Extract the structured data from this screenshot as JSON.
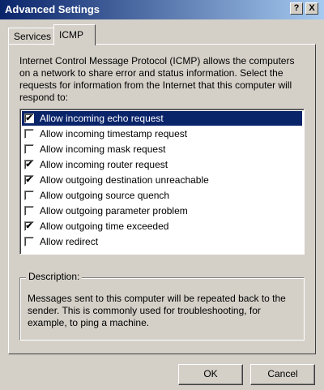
{
  "window": {
    "title": "Advanced Settings",
    "help_button": "?",
    "close_button": "X"
  },
  "tabs": [
    {
      "label": "Services",
      "active": false
    },
    {
      "label": "ICMP",
      "active": true
    }
  ],
  "intro_text": "Internet Control Message Protocol (ICMP) allows the computers on a network to share error and status information. Select the requests for information from the Internet that this computer will respond to:",
  "options": [
    {
      "label": "Allow incoming echo request",
      "checked": true,
      "selected": true
    },
    {
      "label": "Allow incoming timestamp request",
      "checked": false,
      "selected": false
    },
    {
      "label": "Allow incoming mask request",
      "checked": false,
      "selected": false
    },
    {
      "label": "Allow incoming router request",
      "checked": true,
      "selected": false
    },
    {
      "label": "Allow outgoing destination unreachable",
      "checked": true,
      "selected": false
    },
    {
      "label": "Allow outgoing source quench",
      "checked": false,
      "selected": false
    },
    {
      "label": "Allow outgoing parameter problem",
      "checked": false,
      "selected": false
    },
    {
      "label": "Allow outgoing time exceeded",
      "checked": true,
      "selected": false
    },
    {
      "label": "Allow redirect",
      "checked": false,
      "selected": false
    }
  ],
  "description": {
    "legend": "Description:",
    "text": "Messages sent to this computer will be repeated back to the sender. This is commonly used for troubleshooting, for example, to ping a machine."
  },
  "buttons": {
    "ok": "OK",
    "cancel": "Cancel"
  },
  "colors": {
    "titlebar_start": "#0a246a",
    "titlebar_end": "#a6caf0",
    "selection": "#0a246a",
    "face": "#d4d0c8"
  }
}
